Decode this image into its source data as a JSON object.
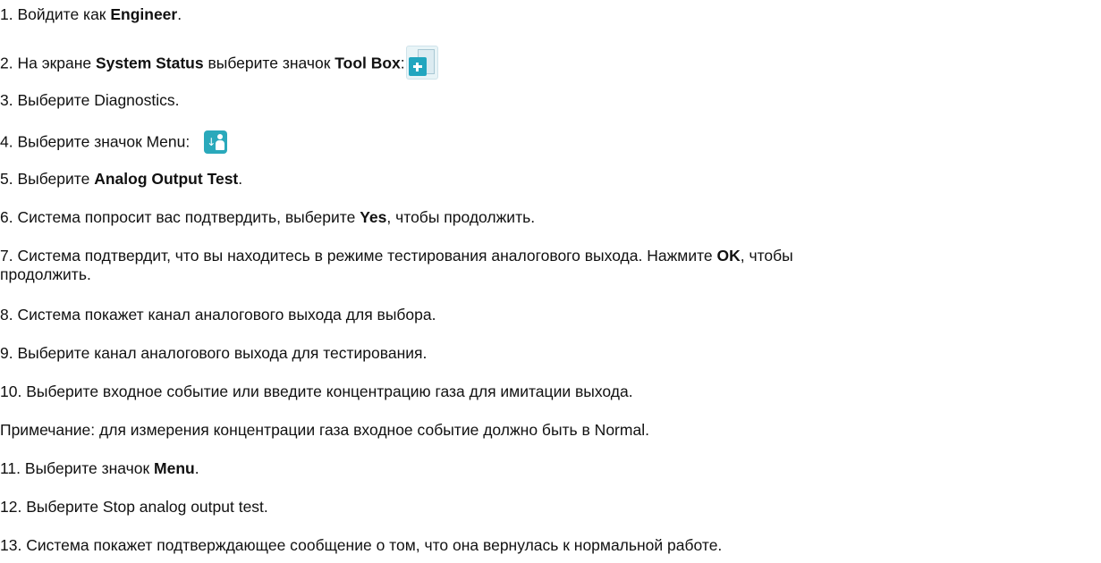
{
  "steps": [
    {
      "pre": "1. Войдите как ",
      "bold": "Engineer",
      "post": "."
    },
    {
      "pre": "2. На экране ",
      "bold": "System Status",
      "mid": " выберите значок ",
      "bold2": "Tool Box",
      "post": ":"
    },
    {
      "text": "3. Выберите Diagnostics."
    },
    {
      "text": "4. Выберите значок Menu:"
    },
    {
      "pre": "5. Выберите ",
      "bold": "Analog Output Test",
      "post": "."
    },
    {
      "pre": "6. Система попросит вас подтвердить, выберите ",
      "bold": "Yes",
      "post": ", чтобы продолжить."
    },
    {
      "pre": "7. Система подтвердит, что вы находитесь в режиме тестирования аналогового выхода. Нажмите ",
      "bold": "OK",
      "post": ", чтобы",
      "wrap": "продолжить."
    },
    {
      "text": "8. Система покажет канал аналогового выхода для выбора."
    },
    {
      "text": "9. Выберите канал аналогового выхода для тестирования."
    },
    {
      "text": "10. Выберите входное событие или введите концентрацию газа для имитации выхода."
    },
    {
      "text": "Примечание: для измерения концентрации газа входное событие должно быть в Normal."
    },
    {
      "pre": "11. Выберите значок ",
      "bold": "Menu",
      "post": "."
    },
    {
      "text": "12. Выберите Stop analog output test."
    },
    {
      "text": "13. Система покажет подтверждающее сообщение о том, что она вернулась к нормальной работе."
    }
  ],
  "icons": {
    "toolbox": "toolbox-icon",
    "menu": "menu-icon",
    "accent": "#22a6bf"
  }
}
